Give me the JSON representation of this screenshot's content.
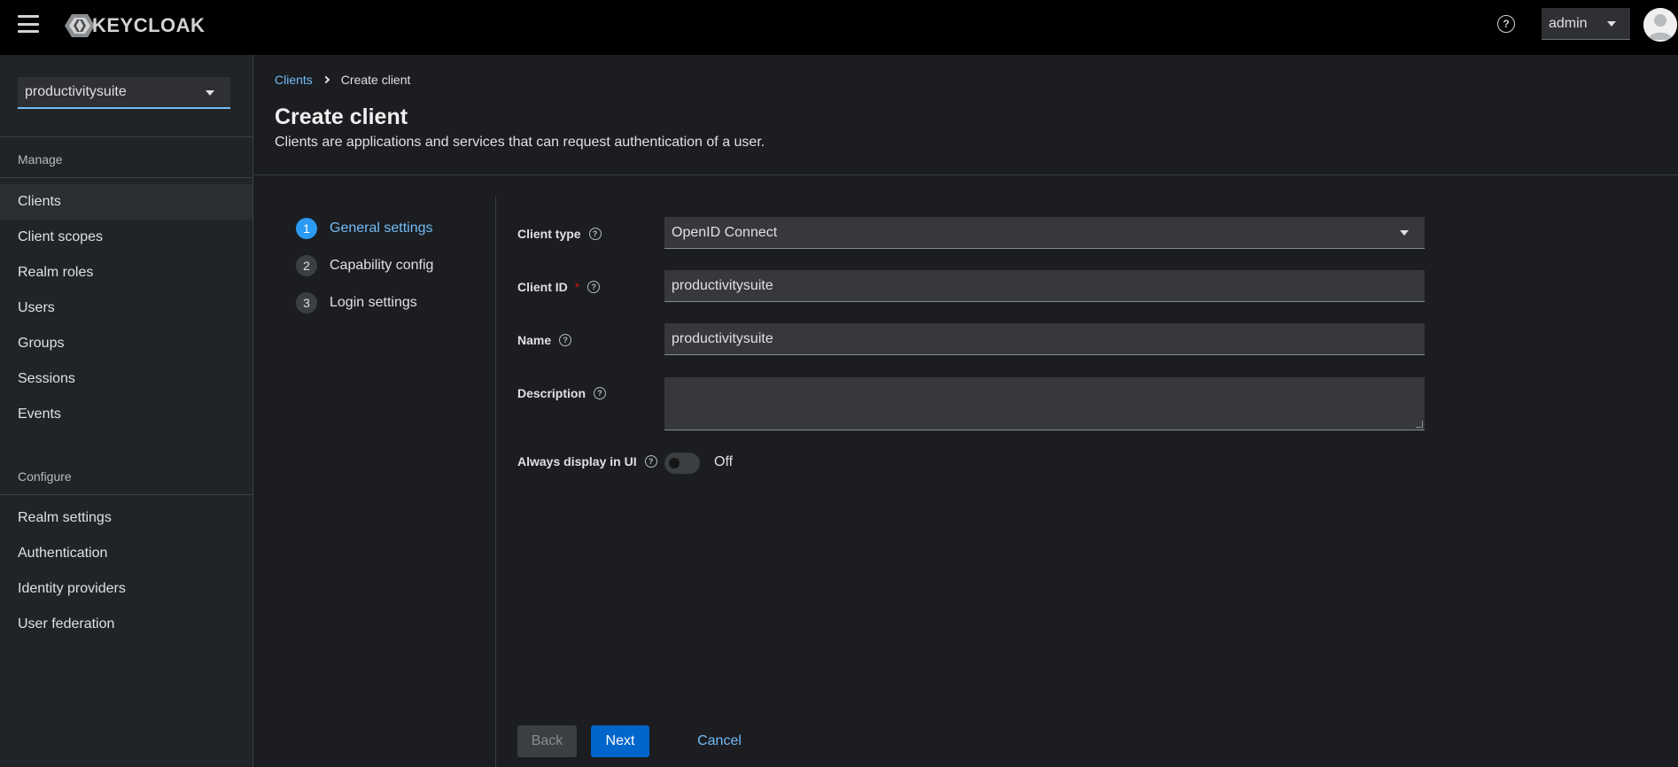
{
  "header": {
    "logo_text": "KEYCLOAK",
    "help_glyph": "?",
    "user_name": "admin"
  },
  "sidebar": {
    "realm": "productivitysuite",
    "manage_title": "Manage",
    "manage_items": [
      "Clients",
      "Client scopes",
      "Realm roles",
      "Users",
      "Groups",
      "Sessions",
      "Events"
    ],
    "configure_title": "Configure",
    "configure_items": [
      "Realm settings",
      "Authentication",
      "Identity providers",
      "User federation"
    ]
  },
  "page": {
    "breadcrumb_link": "Clients",
    "breadcrumb_current": "Create client",
    "title": "Create client",
    "subtitle": "Clients are applications and services that can request authentication of a user."
  },
  "wizard": {
    "steps": [
      {
        "num": "1",
        "label": "General settings"
      },
      {
        "num": "2",
        "label": "Capability config"
      },
      {
        "num": "3",
        "label": "Login settings"
      }
    ]
  },
  "form": {
    "client_type_label": "Client type",
    "client_type_value": "OpenID Connect",
    "client_id_label": "Client ID",
    "client_id_required": "*",
    "client_id_value": "productivitysuite",
    "name_label": "Name",
    "name_value": "productivitysuite",
    "description_label": "Description",
    "always_display_label": "Always display in UI",
    "always_display_state": "Off",
    "help_glyph": "?"
  },
  "footer": {
    "back_label": "Back",
    "next_label": "Next",
    "cancel_label": "Cancel"
  },
  "colors": {
    "accent": "#73bcf7",
    "primary_button": "#0066cc",
    "masthead": "#000000",
    "required": "#c9190b"
  },
  "icons": {
    "menu": "hamburger-icon",
    "help": "help-circle-icon",
    "avatar": "user-avatar-icon",
    "dropdown": "caret-down-icon",
    "breadcrumb": "chevron-right-icon"
  }
}
